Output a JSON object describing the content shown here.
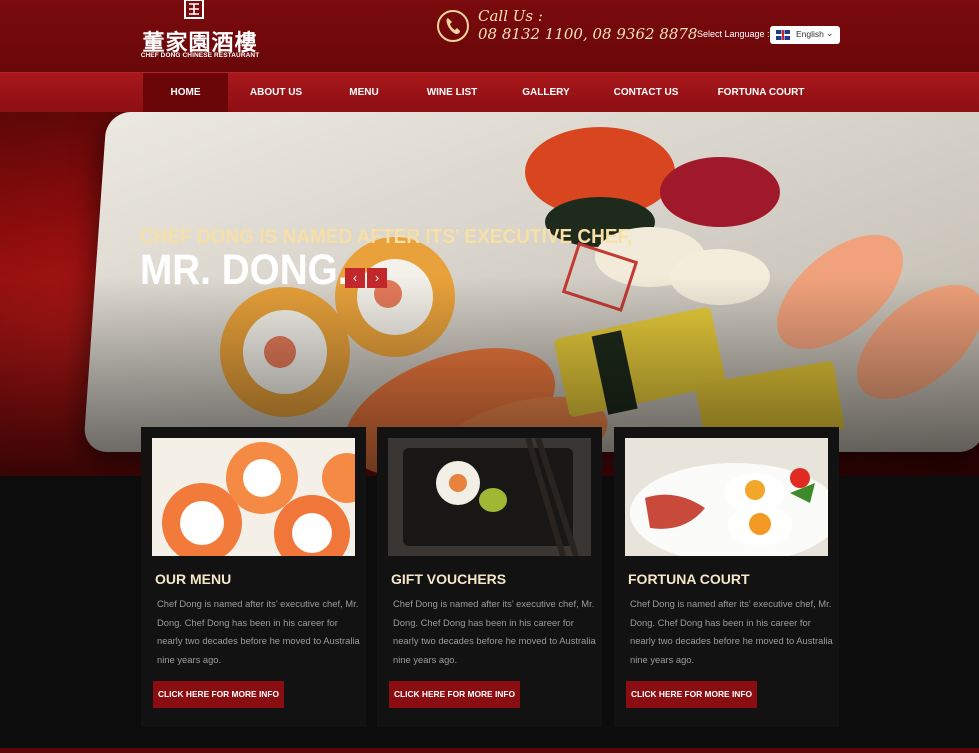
{
  "header": {
    "logo": {
      "chinese_name": "董家園酒樓",
      "english_name": "CHEF DONG CHINESE RESTAURANT"
    },
    "call_label": "Call Us :",
    "call_numbers": "08 8132 1100, 08 9362 8878",
    "language_label": "Select Language :",
    "language_selected": "English"
  },
  "nav": {
    "items": [
      {
        "label": "HOME",
        "active": true
      },
      {
        "label": "ABOUT US"
      },
      {
        "label": "MENU"
      },
      {
        "label": "WINE LIST"
      },
      {
        "label": "GALLERY"
      },
      {
        "label": "CONTACT US"
      },
      {
        "label": "FORTUNA COURT"
      }
    ]
  },
  "hero": {
    "headline_small": "CHEF DONG IS NAMED AFTER ITS’ EXECUTIVE CHEF,",
    "headline_large": "MR. DONG.",
    "prev_icon": "chevron-left-icon",
    "next_icon": "chevron-right-icon"
  },
  "cards": [
    {
      "title": "OUR MENU",
      "description": "Chef Dong is named after its’ executive chef, Mr. Dong. Chef Dong has been in his career for nearly two decades before he moved to Australia nine years ago.",
      "button": "CLICK HERE FOR MORE INFO"
    },
    {
      "title": "GIFT VOUCHERS",
      "description": "Chef Dong is named after its’ executive chef, Mr. Dong. Chef Dong has been in his career for nearly two decades before he moved to Australia nine years ago.",
      "button": "CLICK HERE FOR MORE INFO"
    },
    {
      "title": "FORTUNA COURT",
      "description": "Chef Dong is named after its’ executive chef, Mr. Dong. Chef Dong has been in his career for nearly two decades before he moved to Australia nine years ago.",
      "button": "CLICK HERE FOR MORE INFO"
    }
  ],
  "colors": {
    "header_red": "#7a0a0d",
    "nav_red": "#a8171b",
    "button_red": "#8a0e11",
    "gold_text": "#f7dfa6"
  }
}
